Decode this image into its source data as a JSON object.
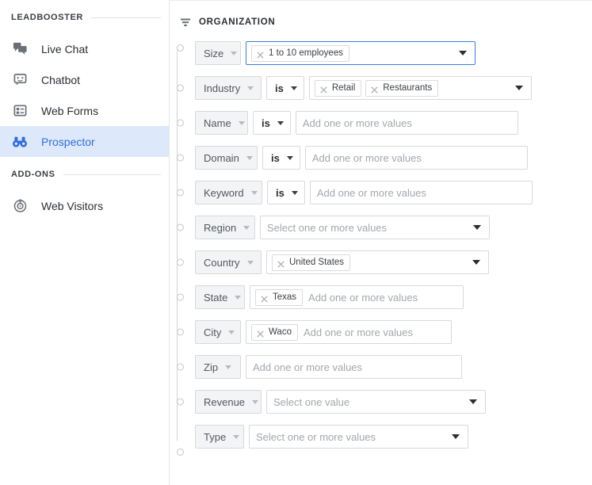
{
  "sidebar": {
    "groups": [
      {
        "title": "LEADBOOSTER",
        "items": [
          {
            "label": "Live Chat",
            "icon": "chat-bubbles-icon",
            "active": false
          },
          {
            "label": "Chatbot",
            "icon": "robot-icon",
            "active": false
          },
          {
            "label": "Web Forms",
            "icon": "web-form-icon",
            "active": false
          },
          {
            "label": "Prospector",
            "icon": "binoculars-icon",
            "active": true
          }
        ]
      },
      {
        "title": "ADD-ONS",
        "items": [
          {
            "label": "Web Visitors",
            "icon": "radar-target-icon",
            "active": false
          }
        ]
      }
    ]
  },
  "main": {
    "section": {
      "icon": "filter-icon",
      "title": "ORGANIZATION"
    },
    "filters": [
      {
        "field": "Size",
        "operator": null,
        "chips": [
          "1 to 10 employees"
        ],
        "placeholder": "",
        "dropdown": true,
        "focused": true,
        "value_width": 290,
        "field_width": 58
      },
      {
        "field": "Industry",
        "operator": "is",
        "chips": [
          "Retail",
          "Restaurants"
        ],
        "placeholder": "",
        "dropdown": true,
        "focused": false,
        "value_width": 281,
        "field_width": 84
      },
      {
        "field": "Name",
        "operator": "is",
        "chips": [],
        "placeholder": "Add one or more values",
        "dropdown": false,
        "focused": false,
        "value_width": 281,
        "field_width": 67
      },
      {
        "field": "Domain",
        "operator": "is",
        "chips": [],
        "placeholder": "Add one or more values",
        "dropdown": false,
        "focused": false,
        "value_width": 281,
        "field_width": 79
      },
      {
        "field": "Keyword",
        "operator": "is",
        "chips": [],
        "placeholder": "Add one or more values",
        "dropdown": false,
        "focused": false,
        "value_width": 281,
        "field_width": 85
      },
      {
        "field": "Region",
        "operator": null,
        "chips": [],
        "placeholder": "Select one or more values",
        "dropdown": true,
        "focused": false,
        "value_width": 290,
        "field_width": 76
      },
      {
        "field": "Country",
        "operator": null,
        "chips": [
          "United States"
        ],
        "placeholder": "",
        "dropdown": true,
        "focused": false,
        "value_width": 281,
        "field_width": 84
      },
      {
        "field": "State",
        "operator": null,
        "chips": [
          "Texas"
        ],
        "placeholder": "Add one or more values",
        "dropdown": false,
        "focused": false,
        "value_width": 270,
        "field_width": 63
      },
      {
        "field": "City",
        "operator": null,
        "chips": [
          "Waco"
        ],
        "placeholder": "Add one or more values",
        "dropdown": false,
        "focused": false,
        "value_width": 260,
        "field_width": 58
      },
      {
        "field": "Zip",
        "operator": null,
        "chips": [],
        "placeholder": "Add one or more values",
        "dropdown": false,
        "focused": false,
        "value_width": 273,
        "field_width": 53
      },
      {
        "field": "Revenue",
        "operator": null,
        "chips": [],
        "placeholder": "Select one value",
        "dropdown": true,
        "focused": false,
        "value_width": 277,
        "field_width": 84
      },
      {
        "field": "Type",
        "operator": null,
        "chips": [],
        "placeholder": "Select one or more values",
        "dropdown": true,
        "focused": false,
        "value_width": 277,
        "field_width": 62
      }
    ]
  },
  "colors": {
    "accent": "#2f6fdb",
    "active_bg": "#dde8fb",
    "focus_border": "#3b7ddd",
    "border": "#d6d9dd",
    "text": "#2b2e33",
    "muted": "#a3a7ad"
  }
}
